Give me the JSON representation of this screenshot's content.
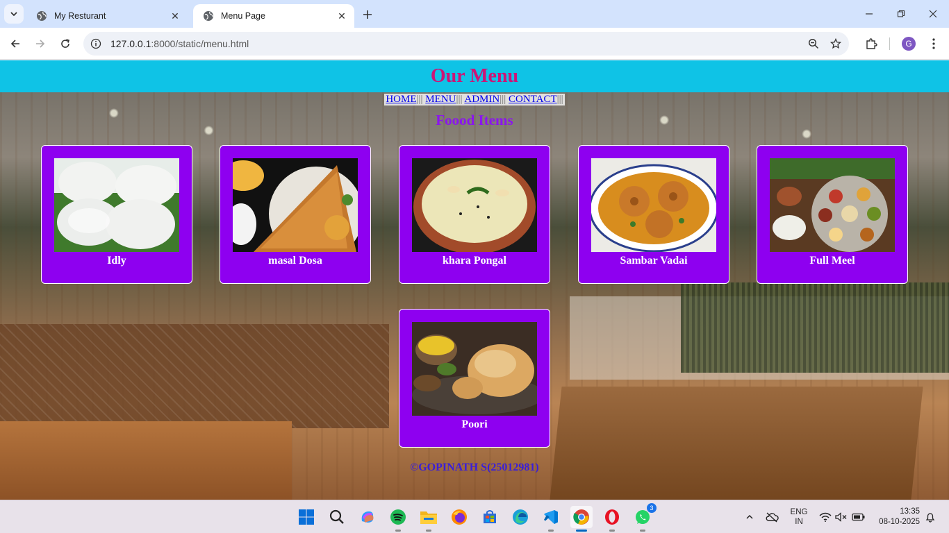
{
  "browser": {
    "tabs": [
      {
        "title": "My Resturant"
      },
      {
        "title": "Menu Page"
      }
    ],
    "url_host": "127.0.0.1",
    "url_rest": ":8000/static/menu.html",
    "profile_initial": "G"
  },
  "page": {
    "header_title": "Our Menu",
    "nav": {
      "home": "HOME",
      "menu": "MENU",
      "admin": "ADMIN",
      "contact": "CONTACT",
      "separator": "|||"
    },
    "subtitle": "Foood Items",
    "items": [
      {
        "name": "Idly"
      },
      {
        "name": "masal Dosa"
      },
      {
        "name": "khara Pongal"
      },
      {
        "name": "Sambar Vadai"
      },
      {
        "name": "Full Meel"
      },
      {
        "name": "Poori"
      }
    ],
    "footer": "©GOPINATH S(25012981)",
    "colors": {
      "header_bg": "#0fc3e6",
      "header_text": "#cc1577",
      "card_bg": "#8e00f0",
      "subtitle": "#8b15ee",
      "footer": "#3a1fd8"
    }
  },
  "taskbar": {
    "apps": [
      "start-icon",
      "search-icon",
      "copilot-icon",
      "spotify-icon",
      "file-explorer-icon",
      "firefox-icon",
      "store-icon",
      "edge-icon",
      "vscode-icon",
      "chrome-icon",
      "opera-icon",
      "whatsapp-icon"
    ],
    "whatsapp_badge": "3",
    "lang_1": "ENG",
    "lang_2": "IN",
    "time": "13:35",
    "date": "08-10-2025"
  }
}
